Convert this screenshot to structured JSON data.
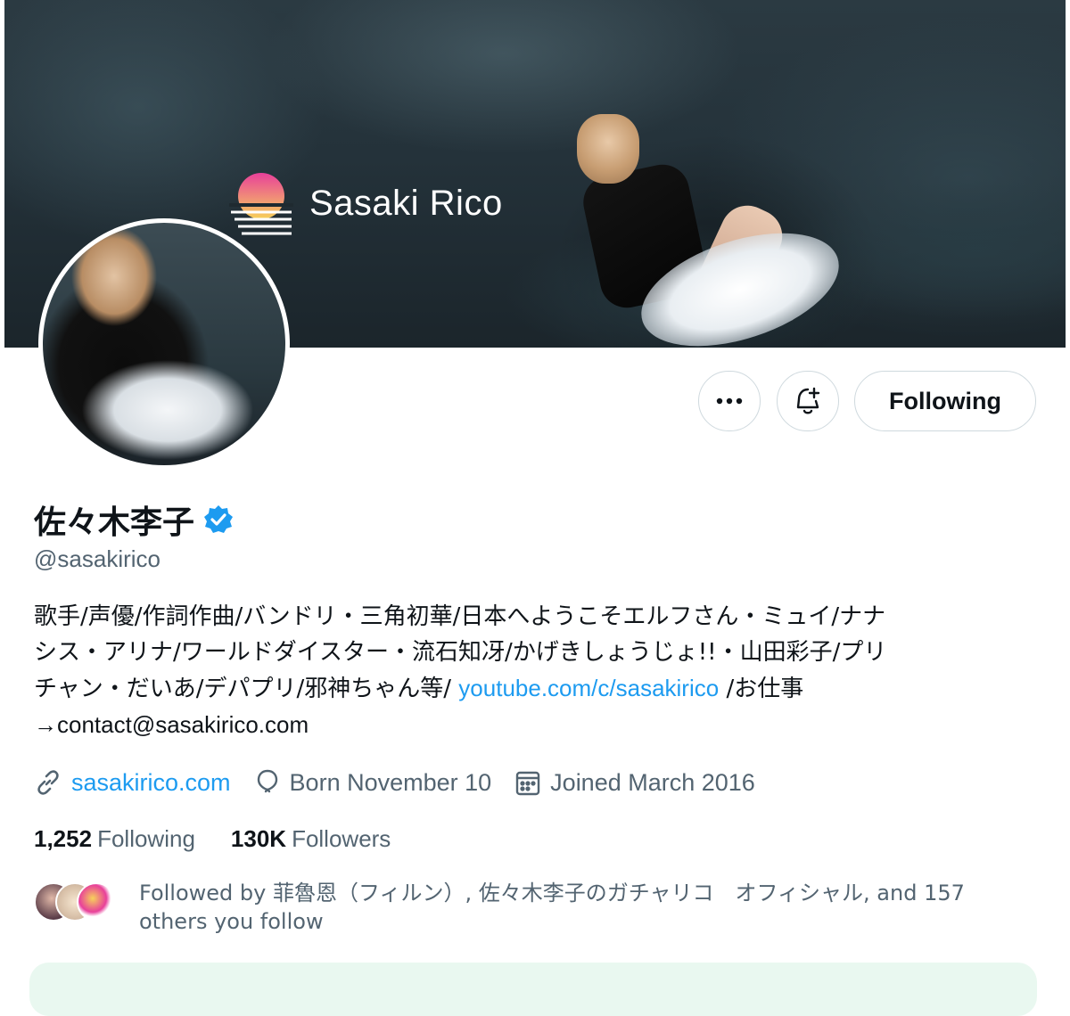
{
  "banner": {
    "logo_text": "Sasaki Rico"
  },
  "actions": {
    "more_icon": "more-icon",
    "notify_icon": "bell-plus-icon",
    "following_label": "Following"
  },
  "profile": {
    "display_name": "佐々木李子",
    "verified_icon": "verified-badge-icon",
    "handle": "@sasakirico",
    "bio_line1": "歌手/声優/作詞作曲/バンドリ・三角初華/日本へようこそエルフさん・ミュイ/ナナ",
    "bio_line2": "シス・アリナ/ワールドダイスター・流石知冴/かげきしょうじょ!!・山田彩子/プリ",
    "bio_line3_pre": "チャン・だいあ/デパプリ/邪神ちゃん等/ ",
    "bio_link": "youtube.com/c/sasakirico",
    "bio_line3_post": " /お仕事",
    "bio_line4": "→contact@sasakirico.com",
    "website": "sasakirico.com",
    "birthday": "Born November 10",
    "joined": "Joined March 2016",
    "following_count": "1,252",
    "following_label": "Following",
    "followers_count": "130K",
    "followers_label": "Followers",
    "followed_by_line1": "Followed by 菲魯恩（フィルン）, 佐々木李子のガチャリコ　オフィシャル, and 157",
    "followed_by_line2": "others you follow"
  },
  "colors": {
    "accent": "#1d9bf0",
    "secondary_text": "#536471",
    "border": "#cfd9de"
  }
}
